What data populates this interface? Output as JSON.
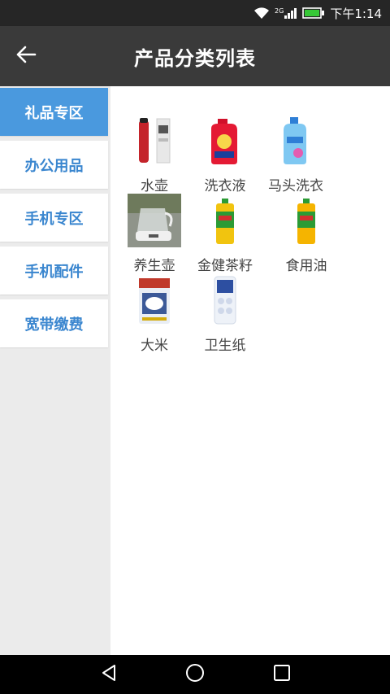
{
  "status_bar": {
    "time": "下午1:14",
    "network_label": "2G",
    "icons": [
      "wifi-icon",
      "signal-icon",
      "battery-icon"
    ]
  },
  "app_bar": {
    "title": "产品分类列表",
    "back_icon": "arrow-left-icon"
  },
  "sidebar": {
    "items": [
      {
        "label": "礼品专区",
        "active": true
      },
      {
        "label": "办公用品",
        "active": false
      },
      {
        "label": "手机专区",
        "active": false
      },
      {
        "label": "手机配件",
        "active": false
      },
      {
        "label": "宽带缴费",
        "active": false
      }
    ]
  },
  "products": [
    {
      "name": "水壶"
    },
    {
      "name": "洗衣液"
    },
    {
      "name": "马头洗衣"
    },
    {
      "name": "养生壶"
    },
    {
      "name": "金健茶籽"
    },
    {
      "name": "食用油"
    },
    {
      "name": "大米"
    },
    {
      "name": "卫生纸"
    }
  ],
  "nav_bar": {
    "icons": [
      "back-triangle-icon",
      "home-circle-icon",
      "recents-square-icon"
    ]
  },
  "colors": {
    "accent": "#4a99de",
    "sidebar_text": "#3a86cf",
    "app_bar": "#3a3a3a",
    "status_bar": "#262626"
  }
}
